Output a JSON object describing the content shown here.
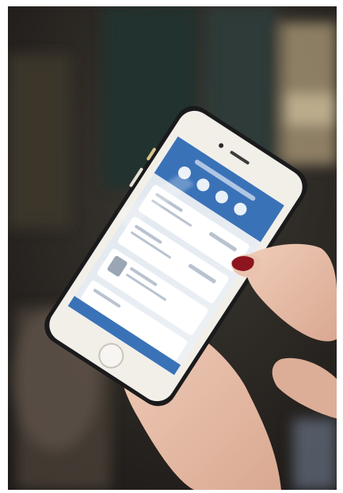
{
  "scene": {
    "subject": "hand-holding-smartphone",
    "phone_color": "#f2efe9",
    "app_accent": "#3a72b8",
    "nail_color": "#8e1520",
    "skin_color": "#e7c2ad"
  }
}
